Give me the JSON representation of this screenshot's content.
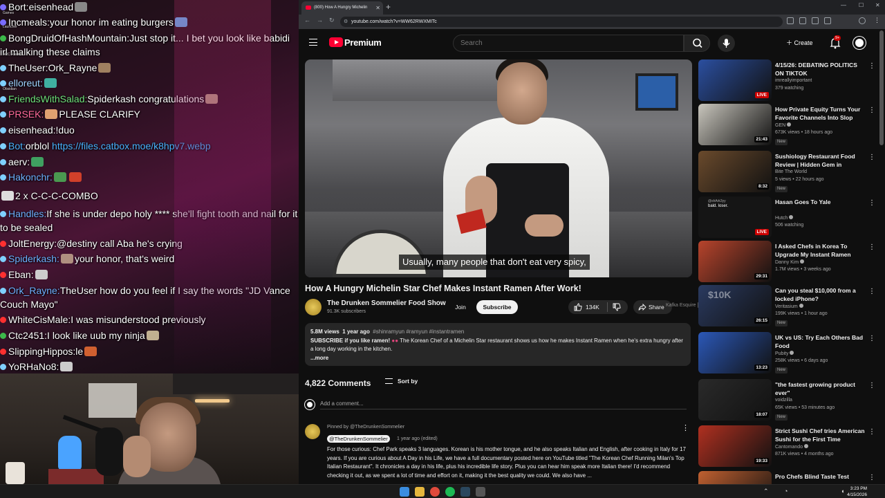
{
  "chat": {
    "lines": [
      {
        "user": "Bort",
        "sep": ":",
        "msg": "eisenhead",
        "user_color": "#ffffff",
        "badge": "#7a6cff",
        "emotes": [
          "#888"
        ]
      },
      {
        "user": "Incmeals",
        "sep": ":",
        "msg": "your honor im eating burgers",
        "user_color": "#ffffff",
        "badge": "#7a6cff",
        "emotes": [
          "#5a9bd8"
        ]
      },
      {
        "user": "BongDruidOfHashMountain",
        "sep": ":",
        "msg": "Just stop it... I bet you look like babidi irl malking these claims",
        "user_color": "#ffffff",
        "badge": "#3cb84a",
        "emotes": []
      },
      {
        "user": "TheUser",
        "sep": ":",
        "msg": "Ork_Rayne",
        "user_color": "#ffffff",
        "badge": "#7fd0ff",
        "emotes": [
          "#a08060"
        ]
      },
      {
        "user": "elloreut",
        "sep": ":",
        "msg": "",
        "user_color": "#9fd3ff",
        "badge": "#7fd0ff",
        "emotes": [
          "#3fb0a0"
        ]
      },
      {
        "user": "FriendsWithSalad",
        "sep": ":",
        "msg": "Spiderkash congratulations",
        "user_color": "#6fe07a",
        "badge": "#7fd0ff",
        "emotes": [
          "#b09080"
        ]
      },
      {
        "user": "PRSEK",
        "sep": ":",
        "msg": "PLEASE CLARIFY",
        "user_color": "#ff6a9a",
        "badge": "#7fd0ff",
        "emotes": [
          "#e0a070"
        ]
      },
      {
        "user": "eisenhead",
        "sep": ":",
        "msg": "!duo",
        "user_color": "#ffffff",
        "badge": "#7fd0ff",
        "emotes": []
      },
      {
        "user": "Bot",
        "sep": ":",
        "msg": "orblol",
        "link": "https://files.catbox.moe/k8hpv7.webp",
        "user_color": "#4ab3ff",
        "badge": "#7fd0ff",
        "emotes": []
      },
      {
        "user": "aerv",
        "sep": ":",
        "msg": "",
        "user_color": "#ffffff",
        "badge": "#7fd0ff",
        "emotes": [
          "#3fa060"
        ]
      },
      {
        "user": "Hakonchr",
        "sep": ":",
        "msg": "",
        "user_color": "#6fb0ff",
        "badge": "#7fd0ff",
        "emotes": [
          "#4a9a50",
          "#d0402a"
        ]
      },
      {
        "user": "",
        "sep": "",
        "msg": "2 x C-C-C-COMBO",
        "user_color": "#ffffff",
        "badge": "",
        "emotes": [
          "#ddd"
        ]
      },
      {
        "user": "Handles",
        "sep": ":",
        "msg": "If she is under depo holy **** she'll fight tooth and nail for it to be sealed",
        "user_color": "#6fb0ff",
        "badge": "#7fd0ff",
        "emotes": []
      },
      {
        "user": "JoltEnergy",
        "sep": ":",
        "msg": "@destiny call Aba he's crying",
        "user_color": "#ffffff",
        "badge": "#ff3030",
        "emotes": []
      },
      {
        "user": "Spiderkash",
        "sep": ":",
        "msg": "your honor, that's weird",
        "user_color": "#6fb0ff",
        "badge": "#7fd0ff",
        "emotes": [
          "#b09080"
        ]
      },
      {
        "user": "Eban",
        "sep": ":",
        "msg": "",
        "user_color": "#ffffff",
        "badge": "#ff3030",
        "emotes": [
          "#ccc"
        ]
      },
      {
        "user": "Ork_Rayne",
        "sep": ":",
        "msg": "TheUser how do you feel if I say the words \"JD Vance Couch Mayo\"",
        "user_color": "#6fb0ff",
        "badge": "#7fd0ff",
        "emotes": []
      },
      {
        "user": "WhiteCisMale",
        "sep": ":",
        "msg": "I was misunderstood previously",
        "user_color": "#ffffff",
        "badge": "#ff3030",
        "emotes": []
      },
      {
        "user": "Ctc2451",
        "sep": ":",
        "msg": "I look like uub my ninja",
        "user_color": "#ffffff",
        "badge": "#3cb84a",
        "emotes": [
          "#c0b090"
        ]
      },
      {
        "user": "SlippingHippos",
        "sep": ":",
        "msg": "le",
        "user_color": "#ffffff",
        "badge": "#ff3030",
        "emotes": [
          "#d06030"
        ]
      },
      {
        "user": "YoRHaNo8",
        "sep": ":",
        "msg": "",
        "user_color": "#ffffff",
        "badge": "#7fd0ff",
        "emotes": [
          "#ccc"
        ]
      }
    ],
    "desktop_icons": [
      "Games",
      "Launcher",
      "ARC Raiders",
      "Obsidian"
    ]
  },
  "browser": {
    "tab_title": "(800) How A Hungry Michelin",
    "url": "youtube.com/watch?v=WW62RWXMITc"
  },
  "youtube": {
    "brand": "Premium",
    "search_placeholder": "Search",
    "create_label": "Create",
    "notification_count": "9+",
    "caption": "Usually, many people that don't eat very spicy,",
    "video_title": "How A Hungry Michelin Star Chef Makes Instant Ramen After Work!",
    "channel_name": "The Drunken Sommelier Food Show",
    "subscribers": "91.3K subscribers",
    "join_label": "Join",
    "subscribe_label": "Subscribe",
    "likes": "134K",
    "share_label": "Share",
    "overlay_text": "Kafka Esquire [Lawyer]",
    "description": {
      "views": "5.8M views",
      "age": "1 year ago",
      "tags": "#shinramyun #ramyun #instantramen",
      "bold_lead": "SUBSCRIBE if you like ramen!",
      "body": "The Korean Chef of a Michelin Star restaurant shows us how he makes Instant Ramen when he's extra hungry after a long day working in the kitchen.",
      "more": "...more"
    },
    "comments_count": "4,822 Comments",
    "sort_label": "Sort by",
    "add_comment_placeholder": "Add a comment...",
    "pinned_comment": {
      "pinned_by": "Pinned by @TheDrunkenSommelier",
      "author": "@TheDrunkenSommelier",
      "time": "1 year ago (edited)",
      "text": "For those curious: Chef Park speaks 3 languages. Korean is his mother tongue, and he also speaks Italian and English, after cooking in Italy for 17 years. If you are curious about A Day in his Life, we have a full documentary posted here on YouTube titled \"The Korean Chef Running Milan's Top Italian Restaurant\". It chronicles a day in his life, plus his incredible life story. Plus you can hear him speak more Italian there! I'd recommend checking it out, as we spent a lot of time and effort on it, making it the best quality we could. We also have ..."
    },
    "recommendations": [
      {
        "title": "4/15/26: DEBATING POLITICS ON TIKTOK",
        "channel": "imreallyimportant",
        "stats": "379 watching",
        "badge": "LIVE",
        "thumb": "#2b4fa0",
        "new": "",
        "verified": false
      },
      {
        "title": "How Private Equity Turns Your Favorite Channels Into Slop",
        "channel": "GEN",
        "stats": "673K views • 18 hours ago",
        "badge": "21:43",
        "thumb": "#c9c6bd",
        "new": "New",
        "verified": true
      },
      {
        "title": "Sushiology Restaurant Food Review | Hidden Gem in Town?...",
        "channel": "Bite The World",
        "stats": "5 views • 22 hours ago",
        "badge": "8:32",
        "thumb": "#6a4a2c",
        "new": "New",
        "verified": false
      },
      {
        "title": "Hasan Goes To Yale",
        "channel": "Hutch",
        "stats": "506 watching",
        "badge": "LIVE",
        "thumb": "#1a1a1a",
        "new": "",
        "verified": true
      },
      {
        "title": "I Asked Chefs in Korea To Upgrade My Instant Ramen",
        "channel": "Danny Kim",
        "stats": "1.7M views • 3 weeks ago",
        "badge": "29:31",
        "thumb": "#b8442c",
        "new": "",
        "verified": true
      },
      {
        "title": "Can you steal $10,000 from a locked iPhone?",
        "channel": "Veritasium",
        "stats": "199K views • 1 hour ago",
        "badge": "26:15",
        "thumb": "#2a3a60",
        "new": "New",
        "verified": true
      },
      {
        "title": "UK vs US: Try Each Others Bad Food",
        "channel": "Pubity",
        "stats": "258K views • 6 days ago",
        "badge": "13:23",
        "thumb": "#2b58b8",
        "new": "New",
        "verified": true
      },
      {
        "title": "\"the fastest growing product ever\"",
        "channel": "voidzilla",
        "stats": "65K views • 53 minutes ago",
        "badge": "18:07",
        "thumb": "#2a2a2a",
        "new": "New",
        "verified": false
      },
      {
        "title": "Strict Sushi Chef tries American Sushi for the First Time",
        "channel": "Cantomando",
        "stats": "871K views • 4 months ago",
        "badge": "19:33",
        "thumb": "#b03020",
        "new": "",
        "verified": true
      },
      {
        "title": "Pro Chefs Blind Taste Test",
        "channel": "",
        "stats": "",
        "badge": "",
        "thumb": "#c06030",
        "new": "",
        "verified": false
      }
    ],
    "overlay_chat": {
      "name": "@shArk3yy",
      "msg": "bald. loser."
    },
    "overlay_sign": "$10K"
  },
  "taskbar": {
    "time": "3:23 PM",
    "date": "4/15/2026"
  }
}
